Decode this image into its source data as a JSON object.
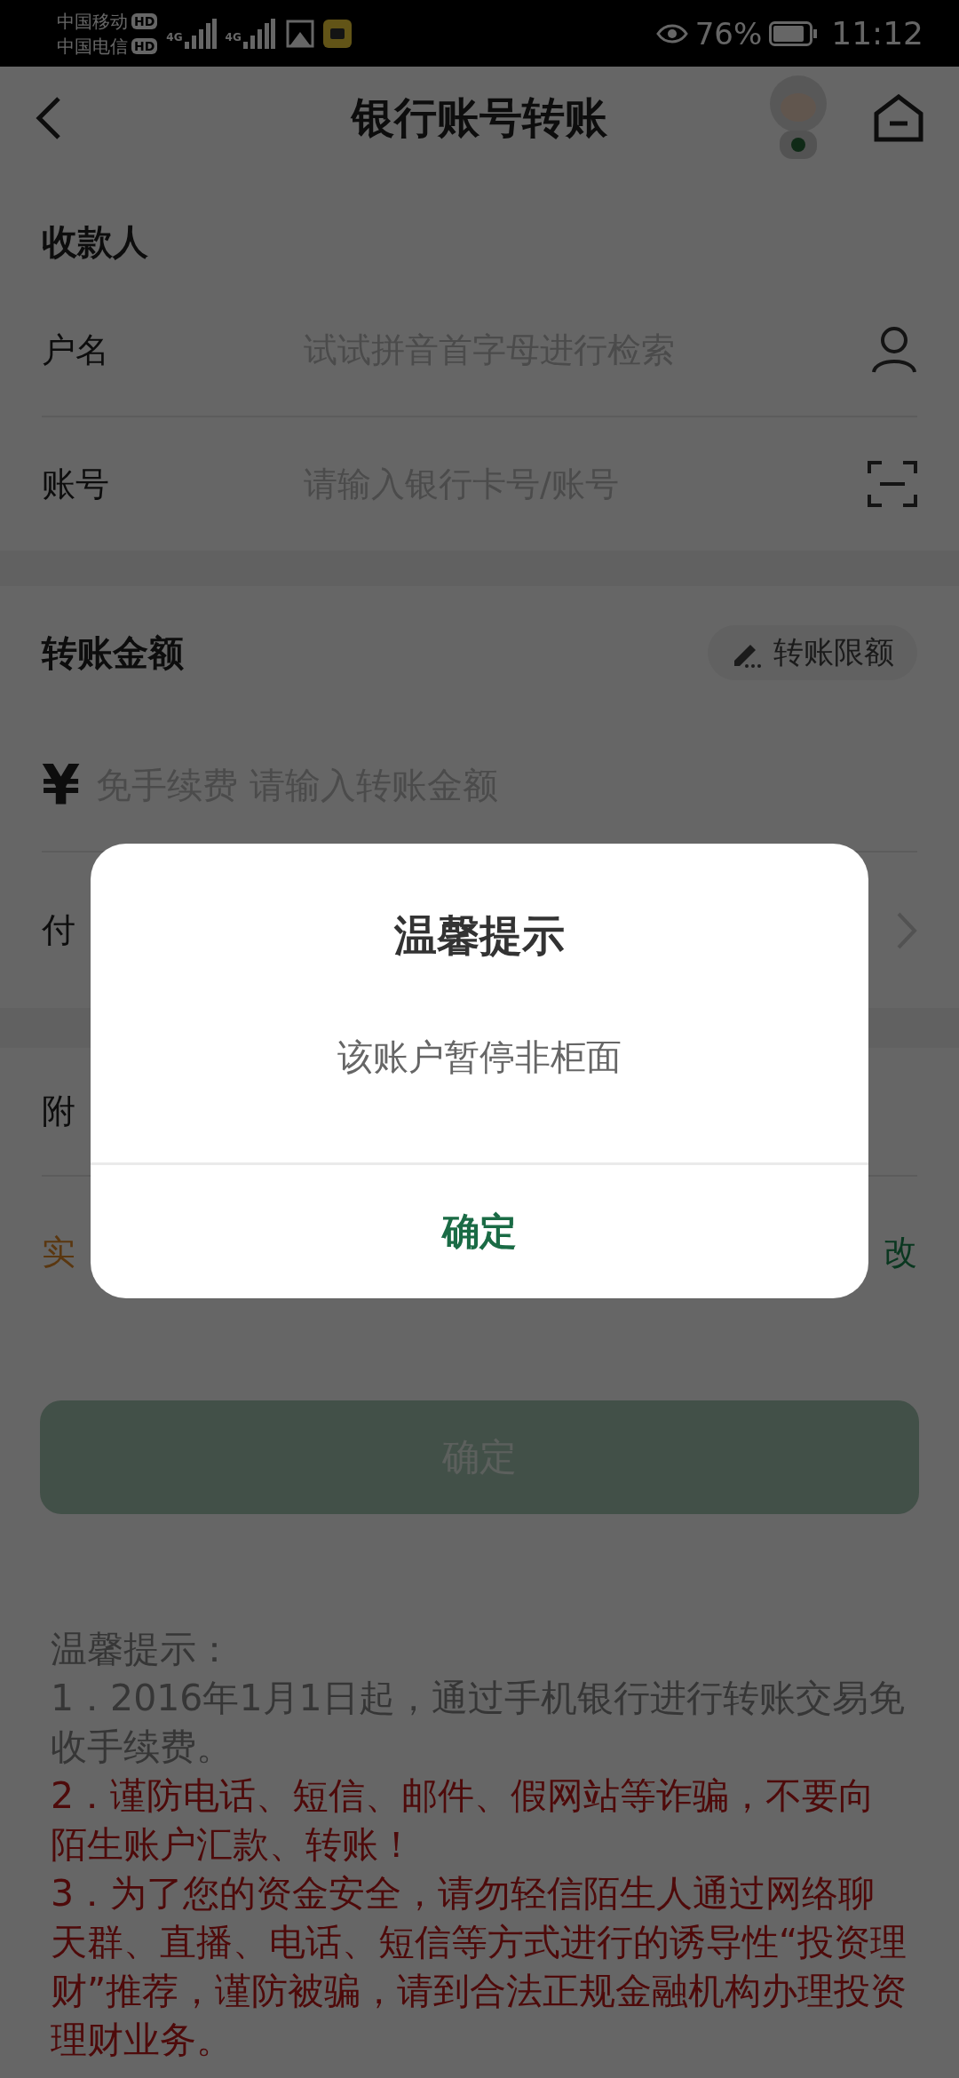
{
  "status_bar": {
    "carriers": [
      {
        "name": "中国移动",
        "badge": "HD"
      },
      {
        "name": "中国电信",
        "badge": "HD"
      }
    ],
    "networks": [
      "4G",
      "4G"
    ],
    "battery": "76%",
    "time": "11:12"
  },
  "header": {
    "title": "银行账号转账"
  },
  "payee": {
    "title": "收款人",
    "fields": [
      {
        "label": "户名",
        "placeholder": "试试拼音首字母进行检索",
        "kind": "contact"
      },
      {
        "label": "账号",
        "placeholder": "请输入银行卡号/账号",
        "kind": "scan"
      }
    ]
  },
  "amount": {
    "title": "转账金额",
    "limit_button": "转账限额",
    "currency": "¥",
    "placeholder": "免手续费 请输入转账金额"
  },
  "payer_row": {
    "label": "付"
  },
  "remark_row": {
    "label": "附"
  },
  "timing_row": {
    "label": "实",
    "action": "改"
  },
  "confirm_button": {
    "label": "确定",
    "disabled": true
  },
  "notes": {
    "title": "温馨提示：",
    "items": [
      {
        "text": "1．2016年1月1日起，通过手机银行进行转账交易免收手续费。",
        "kind": "normal"
      },
      {
        "text": "2．谨防电话、短信、邮件、假网站等诈骗，不要向陌生账户汇款、转账！",
        "kind": "warning"
      },
      {
        "text": "3．为了您的资金安全，请勿轻信陌生人通过网络聊天群、直播、电话、短信等方式进行的诱导性“投资理财”推荐，谨防被骗，请到合法正规金融机构办理投资理财业务。",
        "kind": "warning"
      }
    ]
  },
  "dialog": {
    "title": "温馨提示",
    "message": "该账户暂停非柜面",
    "button": "确定"
  }
}
